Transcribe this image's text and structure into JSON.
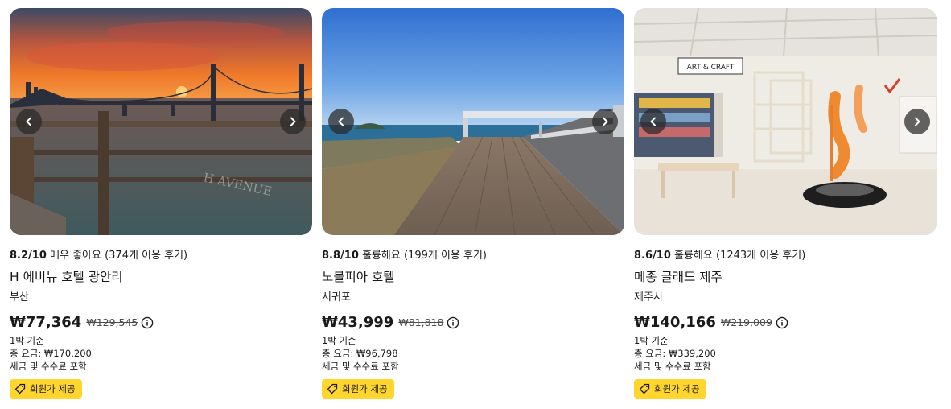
{
  "colors": {
    "badge_bg": "#ffd52e",
    "nav_bg": "#282828",
    "text": "#1a1a1a"
  },
  "icons": {
    "prev": "chevron-left-icon",
    "next": "chevron-right-icon",
    "info": "info-circle-icon",
    "member": "tag-icon"
  },
  "cards": [
    {
      "photo": "bridge-sunset-photo",
      "score": "8.2/10",
      "rating_text": "매우 좋아요 (374개 이용 후기)",
      "name": "H 에비뉴 호텔 광안리",
      "location": "부산",
      "price": "₩77,364",
      "old_price": "₩129,545",
      "per_night": "1박 기준",
      "total": "총 요금: ₩170,200",
      "tax_note": "세금 및 수수료 포함",
      "badge": "회원가 제공"
    },
    {
      "photo": "rooftop-deck-photo",
      "score": "8.8/10",
      "rating_text": "훌륭해요 (199개 이용 후기)",
      "name": "노블피아 호텔",
      "location": "서귀포",
      "price": "₩43,999",
      "old_price": "₩81,818",
      "per_night": "1박 기준",
      "total": "총 요금: ₩96,798",
      "tax_note": "세금 및 수수료 포함",
      "badge": "회원가 제공"
    },
    {
      "photo": "kids-playroom-photo",
      "sign_text": "ART & CRAFT",
      "score": "8.6/10",
      "rating_text": "훌륭해요 (1243개 이용 후기)",
      "name": "메종 글래드 제주",
      "location": "제주시",
      "price": "₩140,166",
      "old_price": "₩219,009",
      "per_night": "1박 기준",
      "total": "총 요금: ₩339,200",
      "tax_note": "세금 및 수수료 포함",
      "badge": "회원가 제공"
    }
  ]
}
